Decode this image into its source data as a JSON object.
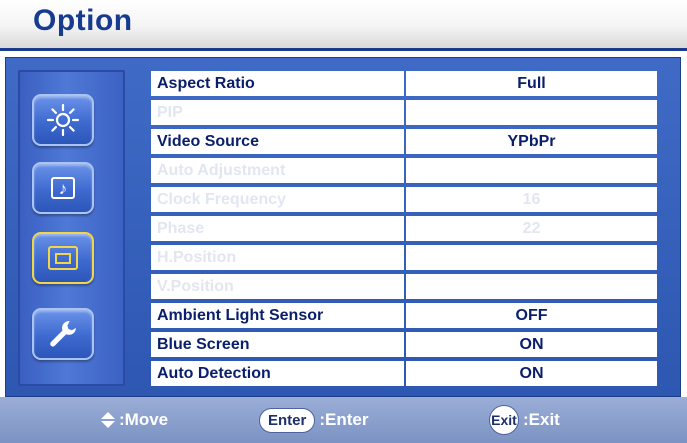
{
  "header": {
    "title": "Option"
  },
  "sidebar": {
    "items": [
      {
        "name": "brightness",
        "icon": "sun-icon",
        "glyph": "☀",
        "active": false
      },
      {
        "name": "audio",
        "icon": "music-note-icon",
        "glyph": "♪",
        "active": false
      },
      {
        "name": "option",
        "icon": "screen-icon",
        "active": true
      },
      {
        "name": "settings",
        "icon": "wrench-icon",
        "active": false
      }
    ]
  },
  "menu": {
    "rows": [
      {
        "label": "Aspect Ratio",
        "value": "Full",
        "enabled": true
      },
      {
        "label": "PIP",
        "value": "",
        "enabled": false
      },
      {
        "label": "Video Source",
        "value": "YPbPr",
        "enabled": true
      },
      {
        "label": "Auto Adjustment",
        "value": "",
        "enabled": false
      },
      {
        "label": "Clock Frequency",
        "value": "16",
        "enabled": false
      },
      {
        "label": "Phase",
        "value": "22",
        "enabled": false
      },
      {
        "label": "H.Position",
        "value": "",
        "enabled": false
      },
      {
        "label": "V.Position",
        "value": "",
        "enabled": false
      },
      {
        "label": "Ambient Light Sensor",
        "value": "OFF",
        "enabled": true
      },
      {
        "label": "Blue Screen",
        "value": "ON",
        "enabled": true
      },
      {
        "label": "Auto Detection",
        "value": "ON",
        "enabled": true
      }
    ]
  },
  "footer": {
    "move_label": ":Move",
    "enter_key": "Enter",
    "enter_label": ":Enter",
    "exit_key": "Exit",
    "exit_label": ":Exit"
  }
}
